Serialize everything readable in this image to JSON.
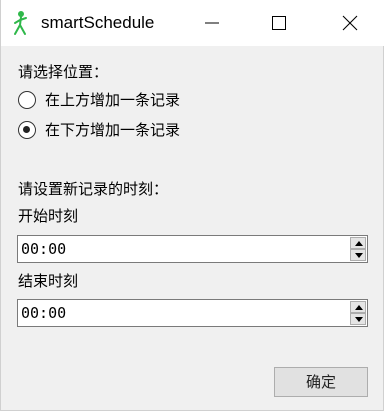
{
  "window": {
    "title": "smartSchedule",
    "icon": "app-icon"
  },
  "position": {
    "prompt": "请选择位置：",
    "options": [
      {
        "label": "在上方增加一条记录",
        "checked": false
      },
      {
        "label": "在下方增加一条记录",
        "checked": true
      }
    ]
  },
  "time": {
    "prompt": "请设置新记录的时刻：",
    "start_label": "开始时刻",
    "start_value": "00:00",
    "end_label": "结束时刻",
    "end_value": "00:00"
  },
  "actions": {
    "ok_label": "确定"
  }
}
